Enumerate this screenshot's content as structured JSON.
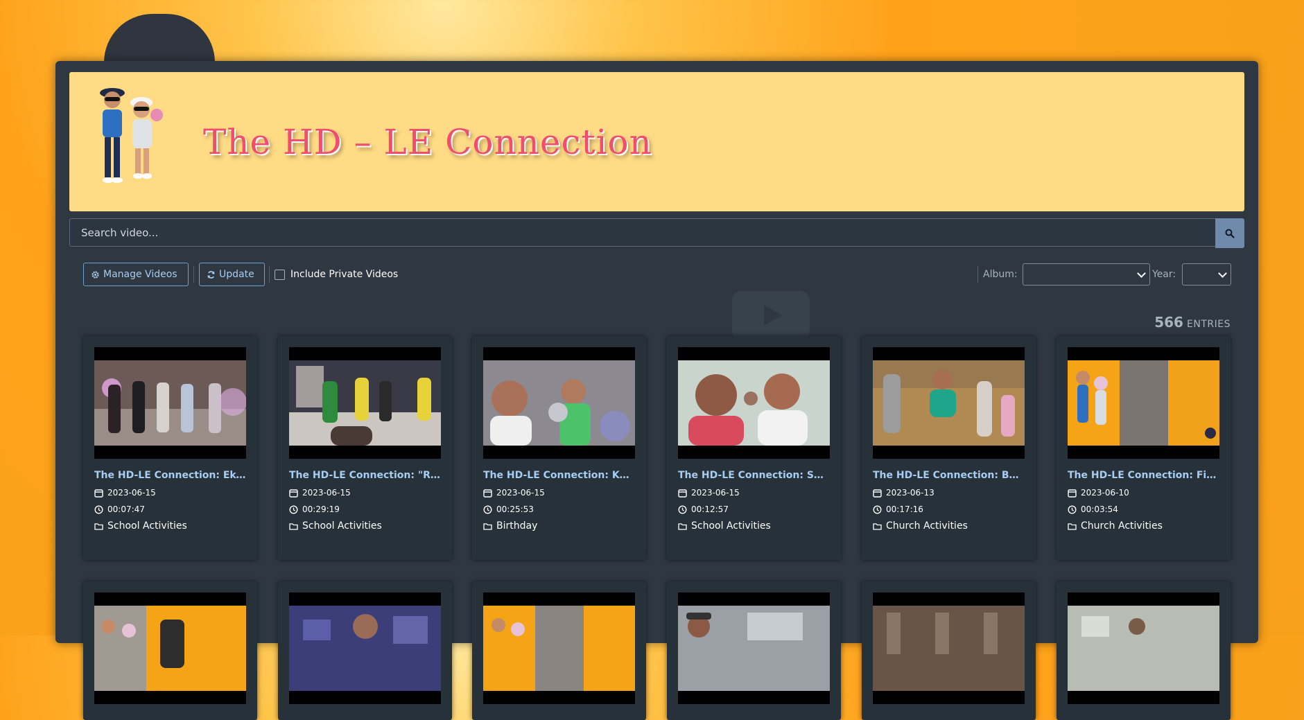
{
  "site": {
    "title": "The HD – LE Connection"
  },
  "search": {
    "placeholder": "Search video..."
  },
  "toolbar": {
    "manage_label": "Manage Videos",
    "update_label": "Update",
    "private_label": "Include Private Videos",
    "private_checked": false,
    "album_label": "Album:",
    "album_value": "",
    "year_label": "Year:",
    "year_value": ""
  },
  "entries": {
    "count": "566",
    "label": "ENTRIES"
  },
  "icons": {
    "search": "search-icon",
    "manage": "gear-icon",
    "update": "refresh-icon",
    "date": "calendar-icon",
    "duration": "clock-icon",
    "album": "folder-icon"
  },
  "colors": {
    "accent": "#a8cdf2",
    "banner": "#ffdb85",
    "title": "#f04e6a",
    "panel": "#2f3841",
    "card": "#27313a"
  },
  "videos": [
    {
      "title": "The HD-LE Connection: Ekor...",
      "date": "2023-06-15",
      "duration": "00:07:47",
      "album": "School Activities"
    },
    {
      "title": "The HD-LE Connection: \"Ron...",
      "date": "2023-06-15",
      "duration": "00:29:19",
      "album": "School Activities"
    },
    {
      "title": "The HD-LE Connection: Kuy...",
      "date": "2023-06-15",
      "duration": "00:25:53",
      "album": "Birthday"
    },
    {
      "title": "The HD-LE Connection: Som...",
      "date": "2023-06-15",
      "duration": "00:12:57",
      "album": "School Activities"
    },
    {
      "title": "The HD-LE Connection: Barn...",
      "date": "2023-06-13",
      "duration": "00:17:16",
      "album": "Church Activities"
    },
    {
      "title": "The HD-LE Connection: First...",
      "date": "2023-06-10",
      "duration": "00:03:54",
      "album": "Church Activities"
    }
  ]
}
